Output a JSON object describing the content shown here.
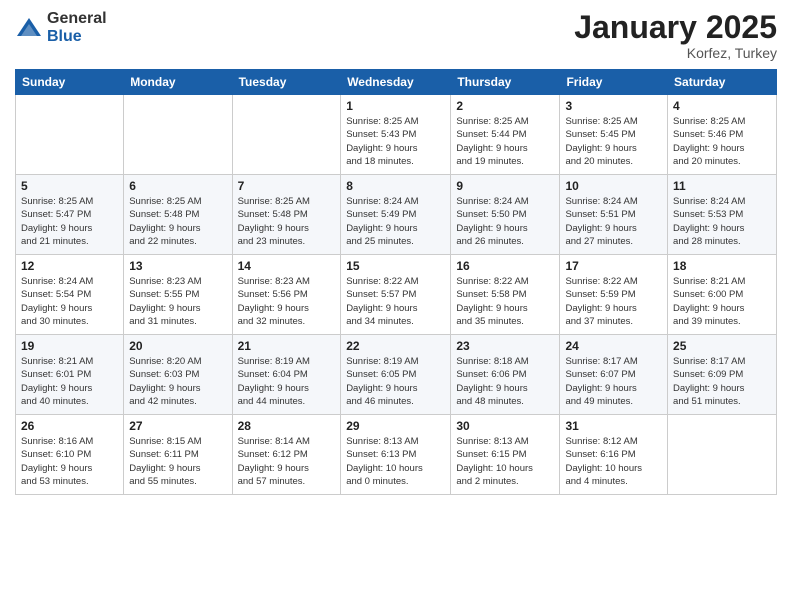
{
  "logo": {
    "general": "General",
    "blue": "Blue"
  },
  "title": {
    "month": "January 2025",
    "location": "Korfez, Turkey"
  },
  "weekdays": [
    "Sunday",
    "Monday",
    "Tuesday",
    "Wednesday",
    "Thursday",
    "Friday",
    "Saturday"
  ],
  "weeks": [
    [
      {
        "day": "",
        "info": ""
      },
      {
        "day": "",
        "info": ""
      },
      {
        "day": "",
        "info": ""
      },
      {
        "day": "1",
        "info": "Sunrise: 8:25 AM\nSunset: 5:43 PM\nDaylight: 9 hours\nand 18 minutes."
      },
      {
        "day": "2",
        "info": "Sunrise: 8:25 AM\nSunset: 5:44 PM\nDaylight: 9 hours\nand 19 minutes."
      },
      {
        "day": "3",
        "info": "Sunrise: 8:25 AM\nSunset: 5:45 PM\nDaylight: 9 hours\nand 20 minutes."
      },
      {
        "day": "4",
        "info": "Sunrise: 8:25 AM\nSunset: 5:46 PM\nDaylight: 9 hours\nand 20 minutes."
      }
    ],
    [
      {
        "day": "5",
        "info": "Sunrise: 8:25 AM\nSunset: 5:47 PM\nDaylight: 9 hours\nand 21 minutes."
      },
      {
        "day": "6",
        "info": "Sunrise: 8:25 AM\nSunset: 5:48 PM\nDaylight: 9 hours\nand 22 minutes."
      },
      {
        "day": "7",
        "info": "Sunrise: 8:25 AM\nSunset: 5:48 PM\nDaylight: 9 hours\nand 23 minutes."
      },
      {
        "day": "8",
        "info": "Sunrise: 8:24 AM\nSunset: 5:49 PM\nDaylight: 9 hours\nand 25 minutes."
      },
      {
        "day": "9",
        "info": "Sunrise: 8:24 AM\nSunset: 5:50 PM\nDaylight: 9 hours\nand 26 minutes."
      },
      {
        "day": "10",
        "info": "Sunrise: 8:24 AM\nSunset: 5:51 PM\nDaylight: 9 hours\nand 27 minutes."
      },
      {
        "day": "11",
        "info": "Sunrise: 8:24 AM\nSunset: 5:53 PM\nDaylight: 9 hours\nand 28 minutes."
      }
    ],
    [
      {
        "day": "12",
        "info": "Sunrise: 8:24 AM\nSunset: 5:54 PM\nDaylight: 9 hours\nand 30 minutes."
      },
      {
        "day": "13",
        "info": "Sunrise: 8:23 AM\nSunset: 5:55 PM\nDaylight: 9 hours\nand 31 minutes."
      },
      {
        "day": "14",
        "info": "Sunrise: 8:23 AM\nSunset: 5:56 PM\nDaylight: 9 hours\nand 32 minutes."
      },
      {
        "day": "15",
        "info": "Sunrise: 8:22 AM\nSunset: 5:57 PM\nDaylight: 9 hours\nand 34 minutes."
      },
      {
        "day": "16",
        "info": "Sunrise: 8:22 AM\nSunset: 5:58 PM\nDaylight: 9 hours\nand 35 minutes."
      },
      {
        "day": "17",
        "info": "Sunrise: 8:22 AM\nSunset: 5:59 PM\nDaylight: 9 hours\nand 37 minutes."
      },
      {
        "day": "18",
        "info": "Sunrise: 8:21 AM\nSunset: 6:00 PM\nDaylight: 9 hours\nand 39 minutes."
      }
    ],
    [
      {
        "day": "19",
        "info": "Sunrise: 8:21 AM\nSunset: 6:01 PM\nDaylight: 9 hours\nand 40 minutes."
      },
      {
        "day": "20",
        "info": "Sunrise: 8:20 AM\nSunset: 6:03 PM\nDaylight: 9 hours\nand 42 minutes."
      },
      {
        "day": "21",
        "info": "Sunrise: 8:19 AM\nSunset: 6:04 PM\nDaylight: 9 hours\nand 44 minutes."
      },
      {
        "day": "22",
        "info": "Sunrise: 8:19 AM\nSunset: 6:05 PM\nDaylight: 9 hours\nand 46 minutes."
      },
      {
        "day": "23",
        "info": "Sunrise: 8:18 AM\nSunset: 6:06 PM\nDaylight: 9 hours\nand 48 minutes."
      },
      {
        "day": "24",
        "info": "Sunrise: 8:17 AM\nSunset: 6:07 PM\nDaylight: 9 hours\nand 49 minutes."
      },
      {
        "day": "25",
        "info": "Sunrise: 8:17 AM\nSunset: 6:09 PM\nDaylight: 9 hours\nand 51 minutes."
      }
    ],
    [
      {
        "day": "26",
        "info": "Sunrise: 8:16 AM\nSunset: 6:10 PM\nDaylight: 9 hours\nand 53 minutes."
      },
      {
        "day": "27",
        "info": "Sunrise: 8:15 AM\nSunset: 6:11 PM\nDaylight: 9 hours\nand 55 minutes."
      },
      {
        "day": "28",
        "info": "Sunrise: 8:14 AM\nSunset: 6:12 PM\nDaylight: 9 hours\nand 57 minutes."
      },
      {
        "day": "29",
        "info": "Sunrise: 8:13 AM\nSunset: 6:13 PM\nDaylight: 10 hours\nand 0 minutes."
      },
      {
        "day": "30",
        "info": "Sunrise: 8:13 AM\nSunset: 6:15 PM\nDaylight: 10 hours\nand 2 minutes."
      },
      {
        "day": "31",
        "info": "Sunrise: 8:12 AM\nSunset: 6:16 PM\nDaylight: 10 hours\nand 4 minutes."
      },
      {
        "day": "",
        "info": ""
      }
    ]
  ]
}
